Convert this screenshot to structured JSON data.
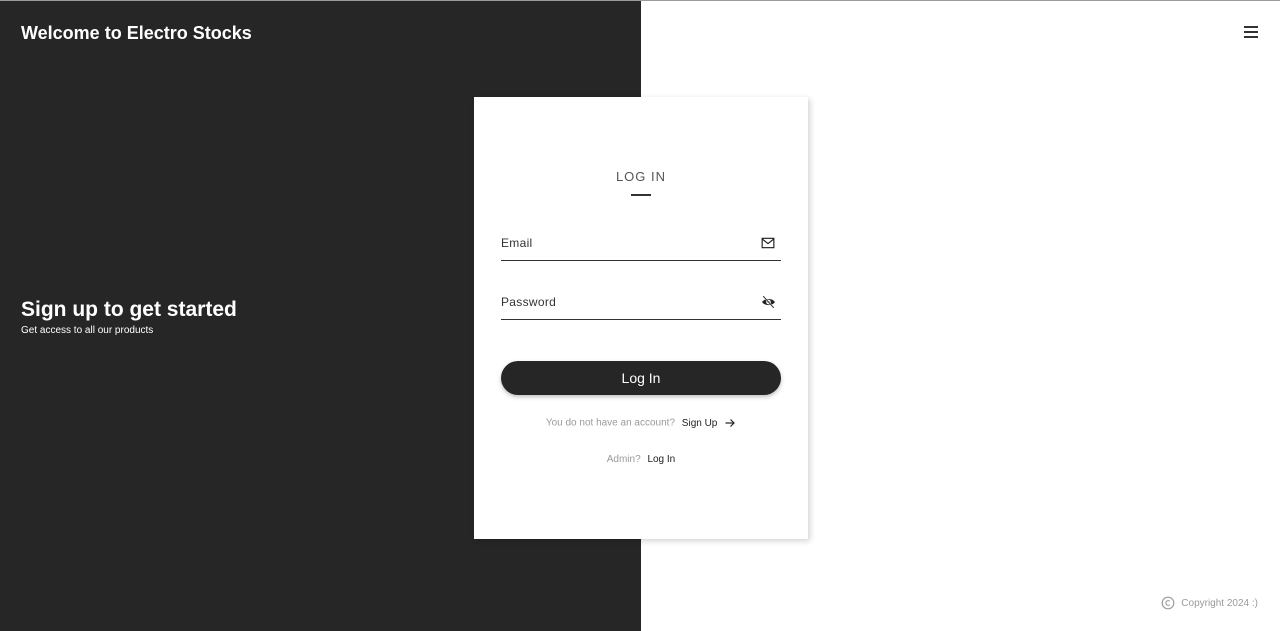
{
  "header": {
    "site_title": "Welcome to Electro Stocks",
    "menu_icon": "hamburger-menu-icon"
  },
  "hero": {
    "title": "Sign up to get started",
    "subtitle": "Get access to all our products"
  },
  "login": {
    "title": "LOG IN",
    "email_placeholder": "Email",
    "email_icon": "mail-icon",
    "password_placeholder": "Password",
    "password_icon": "eye-off-icon",
    "submit_label": "Log In",
    "no_account_text": "You do not have an account?",
    "signup_link": "Sign Up",
    "signup_icon": "arrow-right-icon",
    "admin_text": "Admin?",
    "admin_link": "Log In"
  },
  "footer": {
    "copyright": "Copyright 2024 :)",
    "icon": "copyright-icon"
  },
  "colors": {
    "dark_panel": "#262626",
    "card": "#ffffff",
    "muted_text": "#9a9a9a"
  }
}
